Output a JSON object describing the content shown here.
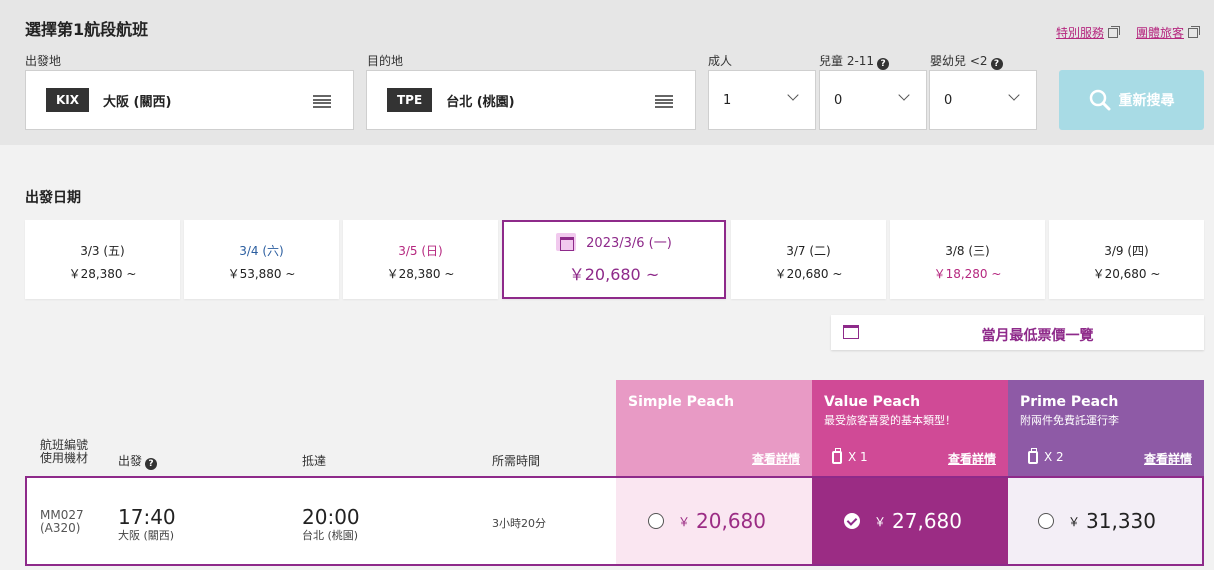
{
  "search": {
    "title": "選擇第1航段航班",
    "links": [
      "特別服務",
      "團體旅客"
    ],
    "origin_label": "出發地",
    "origin_code": "KIX",
    "origin_name": "大阪 (關西)",
    "destination_label": "目的地",
    "destination_code": "TPE",
    "destination_name": "台北 (桃園)",
    "adult_label": "成人",
    "adult_value": "1",
    "child_label": "兒童 2-11",
    "child_value": "0",
    "infant_label": "嬰幼兒 <2",
    "infant_value": "0",
    "search_button": "重新搜尋"
  },
  "dates": {
    "heading": "出發日期",
    "cards": [
      {
        "date": "3/3 (五)",
        "price": "￥28,380 ~"
      },
      {
        "date": "3/4 (六)",
        "price": "￥53,880 ~"
      },
      {
        "date": "3/5 (日)",
        "price": "￥28,380 ~"
      },
      {
        "date": "2023/3/6 (一)",
        "price": "￥20,680 ~"
      },
      {
        "date": "3/7 (二)",
        "price": "￥20,680 ~"
      },
      {
        "date": "3/8 (三)",
        "price": "￥18,280 ~"
      },
      {
        "date": "3/9 (四)",
        "price": "￥20,680 ~"
      }
    ],
    "cheapest_button": "當月最低票價一覽"
  },
  "table": {
    "col_flight": [
      "航班編號",
      "使用機材"
    ],
    "col_depart": "出發",
    "col_arrive": "抵達",
    "col_duration": "所需時間",
    "fares": [
      {
        "name": "Simple Peach",
        "sub": "",
        "bag": "",
        "detail": "查看詳情"
      },
      {
        "name": "Value Peach",
        "sub": "最受旅客喜愛的基本類型！",
        "bag": "X 1",
        "detail": "查看詳情"
      },
      {
        "name": "Prime Peach",
        "sub": "附兩件免費託運行李",
        "bag": "X 2",
        "detail": "查看詳情"
      }
    ]
  },
  "flight": {
    "number": "MM027",
    "aircraft": "(A320)",
    "depart_time": "17:40",
    "depart_place": "大阪 (關西)",
    "arrive_time": "20:00",
    "arrive_place": "台北 (桃園)",
    "duration": "3小時20分",
    "yen": "￥",
    "prices": [
      "20,680",
      "27,680",
      "31,330"
    ],
    "selected_fare": "Value Peach"
  },
  "colors": {
    "simple": "#e89ac5",
    "value": "#d04a96",
    "prime": "#8e5aa6",
    "selected_cell": "#9b2c84",
    "accent": "#8e2a8a"
  }
}
